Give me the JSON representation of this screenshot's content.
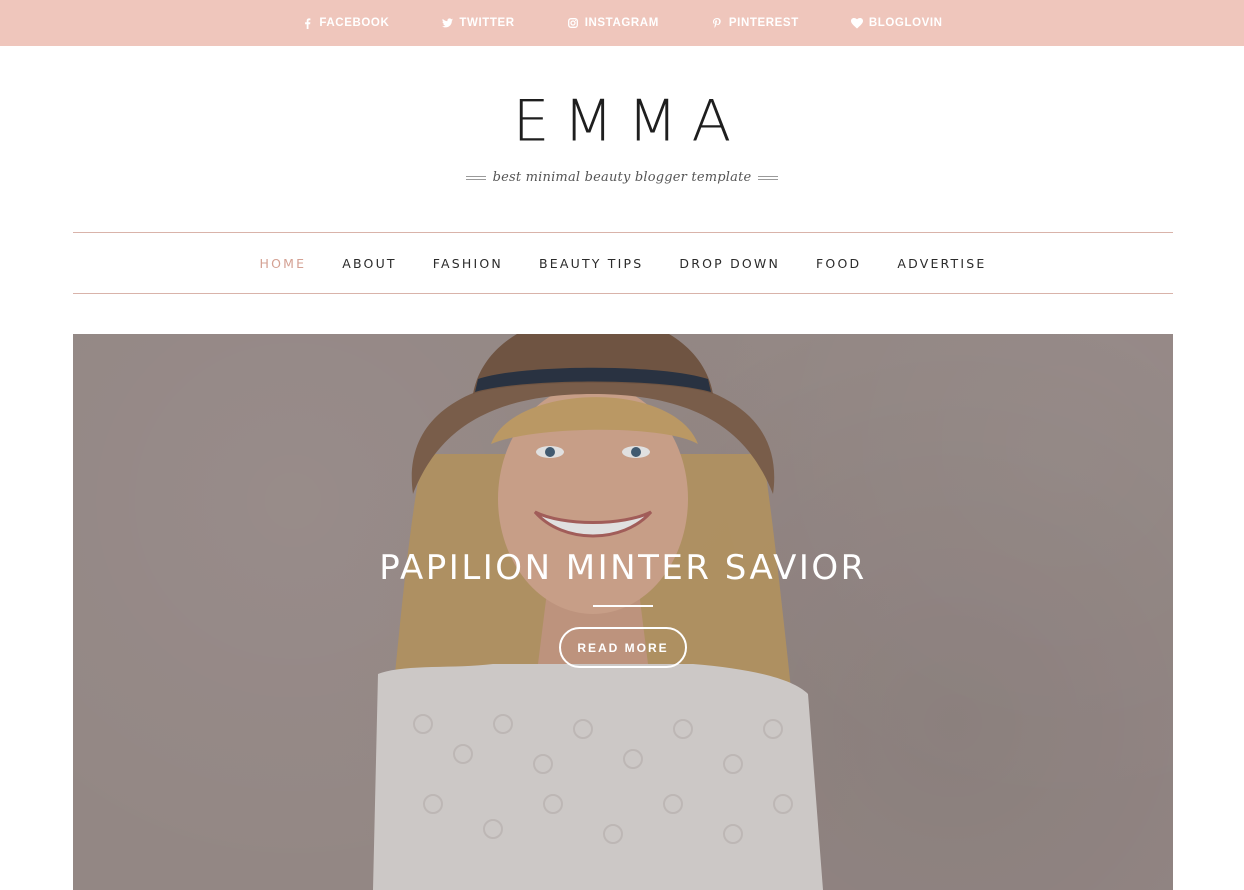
{
  "topbar": {
    "background_color": "#efc6bc",
    "links": [
      {
        "label": "FACEBOOK",
        "icon": "facebook-icon"
      },
      {
        "label": "TWITTER",
        "icon": "twitter-icon"
      },
      {
        "label": "INSTAGRAM",
        "icon": "instagram-icon"
      },
      {
        "label": "PINTEREST",
        "icon": "pinterest-icon"
      },
      {
        "label": "BLOGLOVIN",
        "icon": "heart-icon"
      }
    ]
  },
  "header": {
    "logo": "EMMA",
    "tagline": "best minimal beauty blogger template"
  },
  "nav": {
    "accent_color": "#d4a193",
    "items": [
      {
        "label": "HOME",
        "active": true
      },
      {
        "label": "ABOUT",
        "active": false
      },
      {
        "label": "FASHION",
        "active": false
      },
      {
        "label": "BEAUTY TIPS",
        "active": false
      },
      {
        "label": "DROP DOWN",
        "active": false
      },
      {
        "label": "FOOD",
        "active": false
      },
      {
        "label": "ADVERTISE",
        "active": false
      }
    ]
  },
  "hero": {
    "title": "PAPILION MINTER SAVIOR",
    "button_label": "READ MORE"
  }
}
